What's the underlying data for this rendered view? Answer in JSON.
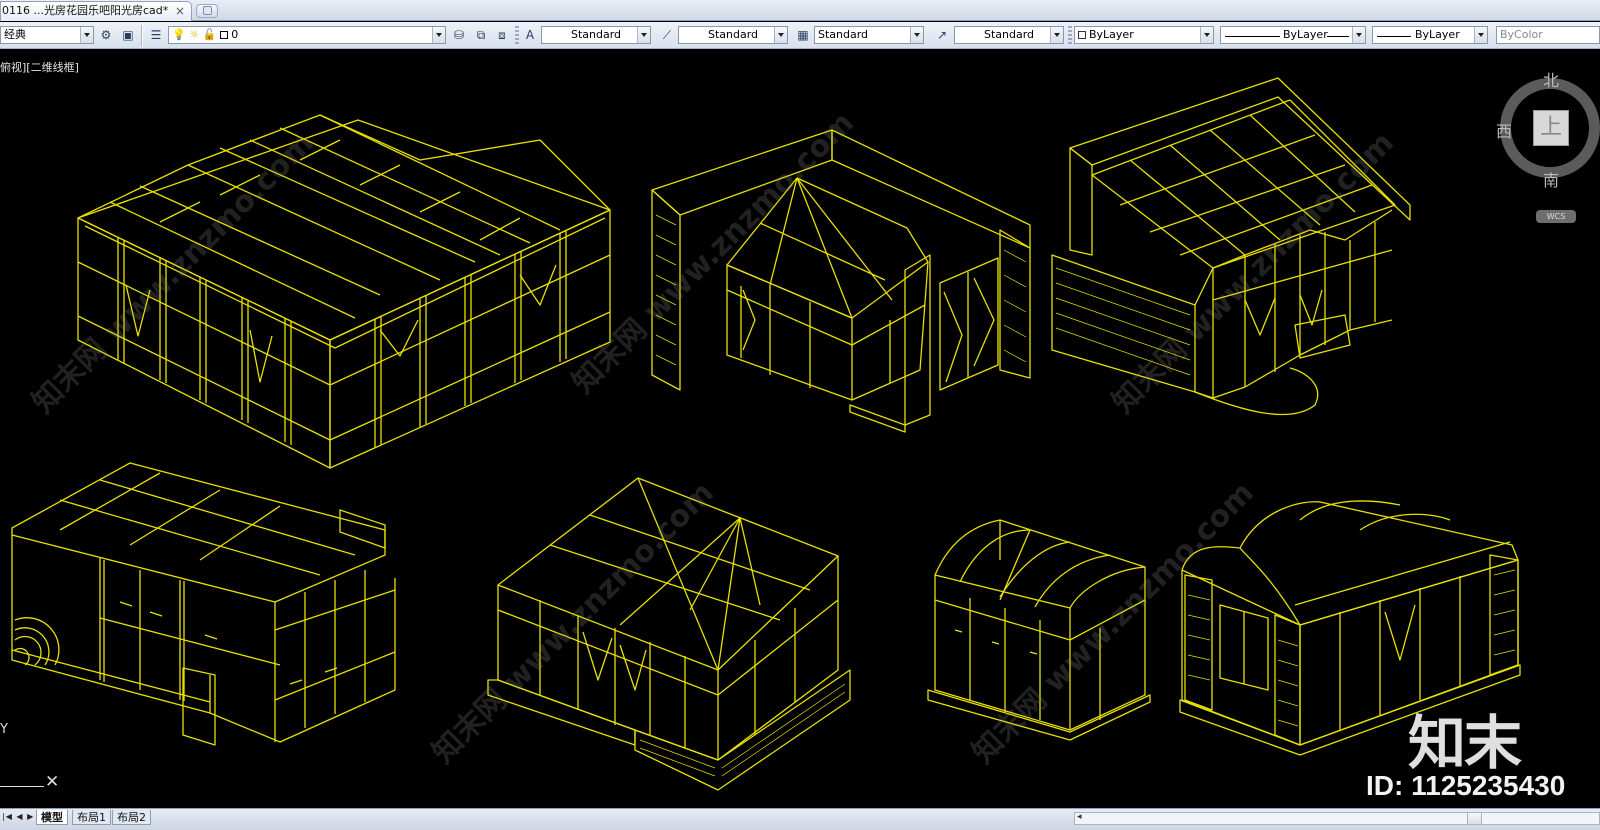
{
  "tab": {
    "title": "0116 ...光房花园乐吧阳光房cad*",
    "close": "×"
  },
  "toolbar": {
    "workspace": "经典",
    "layer": "0",
    "text_style": "Standard",
    "dim_style": "Standard",
    "table_style": "Standard",
    "multileader_style": "Standard",
    "color": "ByLayer",
    "linetype": "ByLayer",
    "lineweight": "ByLayer",
    "plotstyle": "ByColor"
  },
  "viewport": {
    "label": "俯视][二维线框]"
  },
  "viewcube": {
    "north": "北",
    "south": "南",
    "west": "西",
    "top_face": "上",
    "wcs": "WCS"
  },
  "ucs": {
    "y": "Y",
    "x": "X"
  },
  "layout_tabs": [
    {
      "label": "模型",
      "active": true
    },
    {
      "label": "布局1",
      "active": false
    },
    {
      "label": "布局2",
      "active": false
    }
  ],
  "watermark": {
    "logo": "知末",
    "id": "ID: 1125235430",
    "diagonal": "知末网 www.znzmo.com"
  },
  "colors": {
    "drawing_lines": "#e8e000",
    "background": "#000000"
  }
}
